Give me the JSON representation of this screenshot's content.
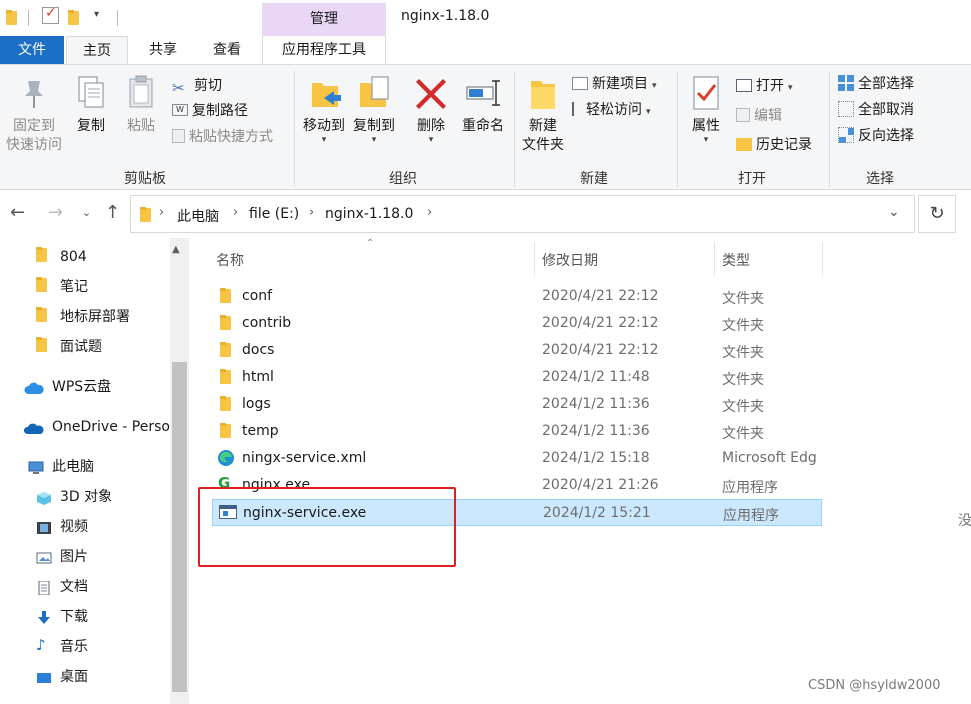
{
  "window": {
    "title": "nginx-1.18.0",
    "manage_tab": "管理"
  },
  "tabs": {
    "file": "文件",
    "home": "主页",
    "share": "共享",
    "view": "查看",
    "app_tools": "应用程序工具"
  },
  "ribbon": {
    "clipboard": {
      "label": "剪贴板",
      "pin": "固定到\n快速访问",
      "pin_line1": "固定到",
      "pin_line2": "快速访问",
      "copy": "复制",
      "paste": "粘贴",
      "cut": "剪切",
      "copy_path": "复制路径",
      "paste_shortcut": "粘贴快捷方式"
    },
    "organize": {
      "label": "组织",
      "move_to": "移动到",
      "copy_to": "复制到",
      "delete": "删除",
      "rename": "重命名"
    },
    "new": {
      "label": "新建",
      "new_folder_line1": "新建",
      "new_folder_line2": "文件夹",
      "new_item": "新建项目",
      "easy_access": "轻松访问"
    },
    "open": {
      "label": "打开",
      "properties": "属性",
      "open": "打开",
      "edit": "编辑",
      "history": "历史记录"
    },
    "select": {
      "label": "选择",
      "select_all": "全部选择",
      "select_none": "全部取消",
      "invert": "反向选择"
    }
  },
  "address": {
    "crumbs": [
      "此电脑",
      "file (E:)",
      "nginx-1.18.0"
    ]
  },
  "navpane": {
    "items": [
      {
        "label": "804",
        "icon": "folder-icon"
      },
      {
        "label": "笔记",
        "icon": "folder-icon"
      },
      {
        "label": "地标屏部署",
        "icon": "folder-icon"
      },
      {
        "label": "面试题",
        "icon": "folder-icon"
      },
      {
        "label": "WPS云盘",
        "icon": "cloud-icon"
      },
      {
        "label": "OneDrive - Perso",
        "icon": "onedrive-icon"
      },
      {
        "label": "此电脑",
        "icon": "computer-icon"
      },
      {
        "label": "3D 对象",
        "icon": "3d-objects-icon"
      },
      {
        "label": "视频",
        "icon": "video-icon"
      },
      {
        "label": "图片",
        "icon": "pictures-icon"
      },
      {
        "label": "文档",
        "icon": "documents-icon"
      },
      {
        "label": "下载",
        "icon": "download-icon"
      },
      {
        "label": "音乐",
        "icon": "music-icon"
      },
      {
        "label": "桌面",
        "icon": "desktop-icon"
      }
    ]
  },
  "list": {
    "columns": {
      "name": "名称",
      "date": "修改日期",
      "type": "类型"
    },
    "rows": [
      {
        "name": "conf",
        "date": "2020/4/21 22:12",
        "type": "文件夹",
        "icon": "folder-icon"
      },
      {
        "name": "contrib",
        "date": "2020/4/21 22:12",
        "type": "文件夹",
        "icon": "folder-icon"
      },
      {
        "name": "docs",
        "date": "2020/4/21 22:12",
        "type": "文件夹",
        "icon": "folder-icon"
      },
      {
        "name": "html",
        "date": "2024/1/2 11:48",
        "type": "文件夹",
        "icon": "folder-icon"
      },
      {
        "name": "logs",
        "date": "2024/1/2 11:36",
        "type": "文件夹",
        "icon": "folder-icon"
      },
      {
        "name": "temp",
        "date": "2024/1/2 11:36",
        "type": "文件夹",
        "icon": "folder-icon"
      },
      {
        "name": "ningx-service.xml",
        "date": "2024/1/2 15:18",
        "type": "Microsoft Edg",
        "icon": "edge-icon"
      },
      {
        "name": "nginx.exe",
        "date": "2020/4/21 21:26",
        "type": "应用程序",
        "icon": "nginx-icon"
      },
      {
        "name": "nginx-service.exe",
        "date": "2024/1/2 15:21",
        "type": "应用程序",
        "icon": "exe-icon",
        "selected": true
      }
    ]
  },
  "right_edge_text": "没",
  "watermark": "CSDN @hsyldw2000",
  "colors": {
    "accent": "#1b6fc4",
    "selection": "#cce8ff",
    "manage": "#ead7f6",
    "annotation": "#e02020"
  }
}
